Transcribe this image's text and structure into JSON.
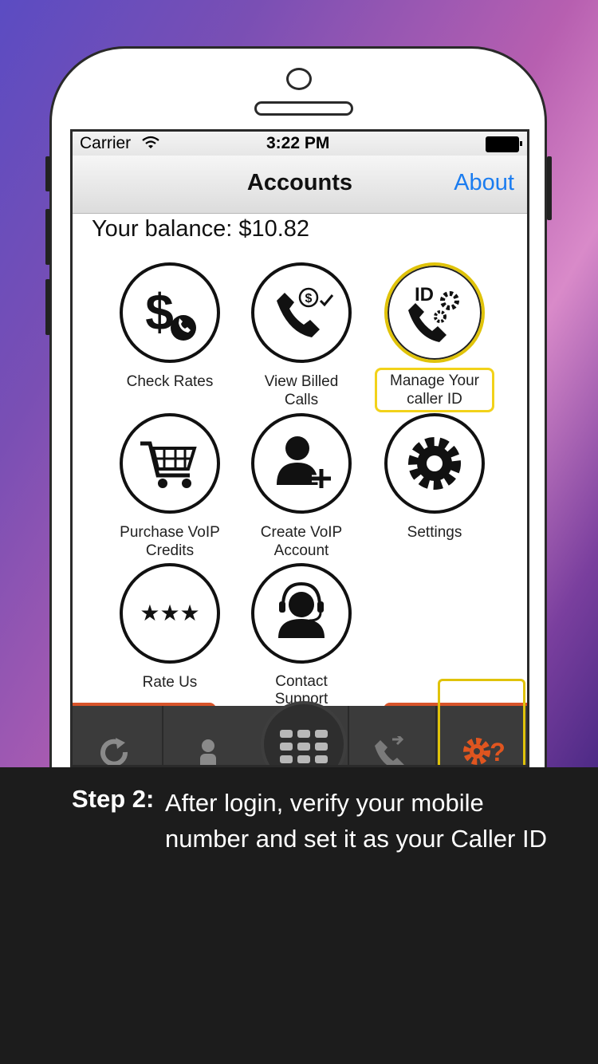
{
  "status_bar": {
    "carrier": "Carrier",
    "time": "3:22 PM"
  },
  "nav": {
    "title": "Accounts",
    "about": "About"
  },
  "balance": "Your balance: $10.82",
  "tiles": [
    {
      "label": "Check Rates",
      "icon": "dollar-phone-icon"
    },
    {
      "label": "View Billed Calls",
      "icon": "phone-billed-icon"
    },
    {
      "label": "Manage Your caller ID",
      "icon": "caller-id-gear-icon",
      "highlighted": true
    },
    {
      "label": "Purchase VoIP Credits",
      "icon": "cart-icon"
    },
    {
      "label": "Create VoIP Account",
      "icon": "add-user-icon"
    },
    {
      "label": "Settings",
      "icon": "gear-icon"
    },
    {
      "label": "Rate Us",
      "icon": "stars-icon"
    },
    {
      "label": "Contact Support",
      "icon": "headset-icon"
    }
  ],
  "tab_bar": {
    "tabs": [
      "refresh-icon",
      "contacts-icon",
      "keypad-icon",
      "call-log-icon",
      "account-settings-icon"
    ],
    "active": "account-settings-icon"
  },
  "caption": {
    "step": "Step 2:",
    "text": "After login, verify your mobile number and set it as your Caller ID"
  },
  "colors": {
    "accent": "#1a7cf0",
    "highlight": "#f2d21a",
    "tab_active": "#e0551f",
    "tab_bar": "#3b3b3b"
  }
}
